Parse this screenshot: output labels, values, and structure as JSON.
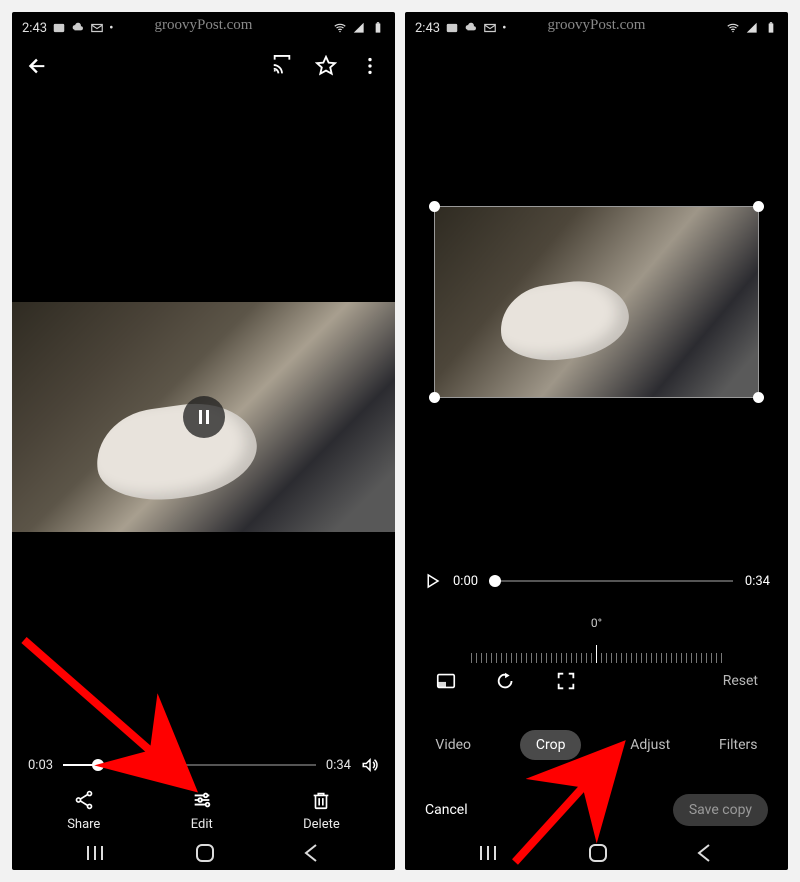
{
  "watermark": "groovyPost.com",
  "status": {
    "time": "2:43"
  },
  "left": {
    "scrub": {
      "current": "0:03",
      "total": "0:34"
    },
    "actions": {
      "share": "Share",
      "edit": "Edit",
      "delete": "Delete"
    }
  },
  "right": {
    "scrub": {
      "current": "0:00",
      "total": "0:34"
    },
    "degree": {
      "label": "0°"
    },
    "tools": {
      "reset": "Reset"
    },
    "tabs": {
      "video": "Video",
      "crop": "Crop",
      "adjust": "Adjust",
      "filters": "Filters"
    },
    "footer": {
      "cancel": "Cancel",
      "save": "Save copy"
    }
  }
}
